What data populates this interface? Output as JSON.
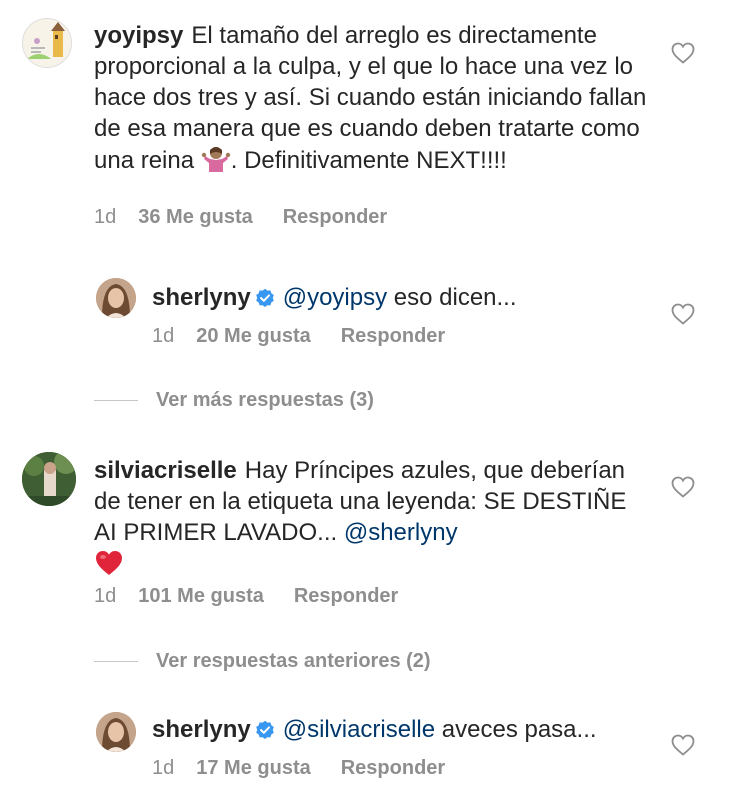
{
  "comments": [
    {
      "username": "yoyipsy",
      "text_1": "El tamaño del arreglo es directamente proporcional a la culpa, y el que lo hace una vez lo hace dos tres y así. Si cuando están iniciando fallan de esa manera que es cuando deben tratarte como una reina ",
      "emoji": "shrug-emoji",
      "text_2": ". Definitivamente NEXT!!!!",
      "time": "1d",
      "likes": "36 Me gusta",
      "reply_label": "Responder"
    },
    {
      "username": "sherlyny",
      "mention": "@yoyipsy",
      "text": " eso dicen...",
      "time": "1d",
      "likes": "20 Me gusta",
      "reply_label": "Responder"
    },
    {
      "username": "silviacriselle",
      "text": "Hay Príncipes azules, que deberían de tener en la etiqueta una leyenda: SE DESTIÑE AI PRIMER LAVADO... ",
      "mention": "@sherlyny",
      "emoji": "red-heart-emoji",
      "time": "1d",
      "likes": "101 Me gusta",
      "reply_label": "Responder"
    },
    {
      "username": "sherlyny",
      "mention": "@silviacriselle",
      "text": " aveces pasa...",
      "time": "1d",
      "likes": "17 Me gusta",
      "reply_label": "Responder"
    }
  ],
  "more_replies": {
    "first": "Ver más respuestas (3)",
    "second": "Ver respuestas anteriores (2)"
  },
  "colors": {
    "text": "#262626",
    "meta": "#8e8e8e",
    "mention": "#00376b",
    "verified": "#3897f0",
    "heart": "#e0245e"
  }
}
